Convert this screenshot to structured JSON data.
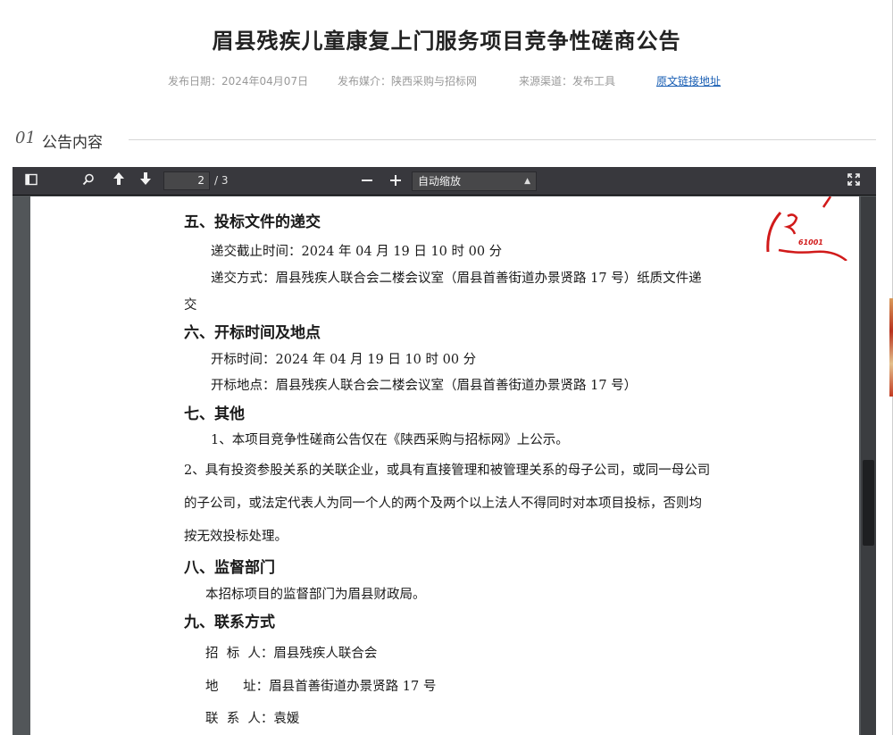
{
  "page": {
    "title": "眉县残疾儿童康复上门服务项目竞争性磋商公告",
    "meta": {
      "publish_date": "发布日期：2024年04月07日",
      "media": "发布媒介：陕西采购与招标网",
      "source": "来源渠道：发布工具",
      "link": "原文链接地址"
    },
    "section": {
      "number": "01",
      "label": "公告内容"
    }
  },
  "viewer": {
    "toolbar": {
      "current_page": "2",
      "total_pages": "/ 3",
      "zoom": "自动缩放"
    },
    "icons": {
      "sidebar": "sidebar-toggle-icon",
      "search": "search-icon",
      "prev": "arrow-up-icon",
      "next": "arrow-down-icon",
      "zoom_out": "minus-icon",
      "zoom_in": "plus-icon",
      "fullscreen": "expand-icon"
    },
    "document": {
      "lines": [
        "五、投标文件的递交",
        "递交截止时间：2024 年 04 月 19 日  10 时 00 分",
        "递交方式：眉县残疾人联合会二楼会议室（眉县首善街道办景贤路 17 号）纸质文件递",
        "交",
        "六、开标时间及地点",
        "开标时间：2024 年 04 月 19 日  10 时 00 分",
        "开标地点：眉县残疾人联合会二楼会议室（眉县首善街道办景贤路 17 号）",
        "七、其他",
        "1、本项目竞争性磋商公告仅在《陕西采购与招标网》上公示。",
        "2、具有投资参股关系的关联企业，或具有直接管理和被管理关系的母子公司，或同一母公司",
        "的子公司，或法定代表人为同一个人的两个及两个以上法人不得同时对本项目投标，否则均",
        "按无效投标处理。",
        "八、监督部门",
        "本招标项目的监督部门为眉县财政局。",
        "九、联系方式",
        "招  标  人：眉县残疾人联合会",
        "地      址：眉县首善街道办景贤路 17 号",
        "联  系  人：袁媛"
      ],
      "seal_text": "61001"
    }
  },
  "colors": {
    "toolbar_bg": "#38383d",
    "viewer_bg": "#525659",
    "link": "#1a5fb4",
    "seal": "#d11a1a"
  }
}
